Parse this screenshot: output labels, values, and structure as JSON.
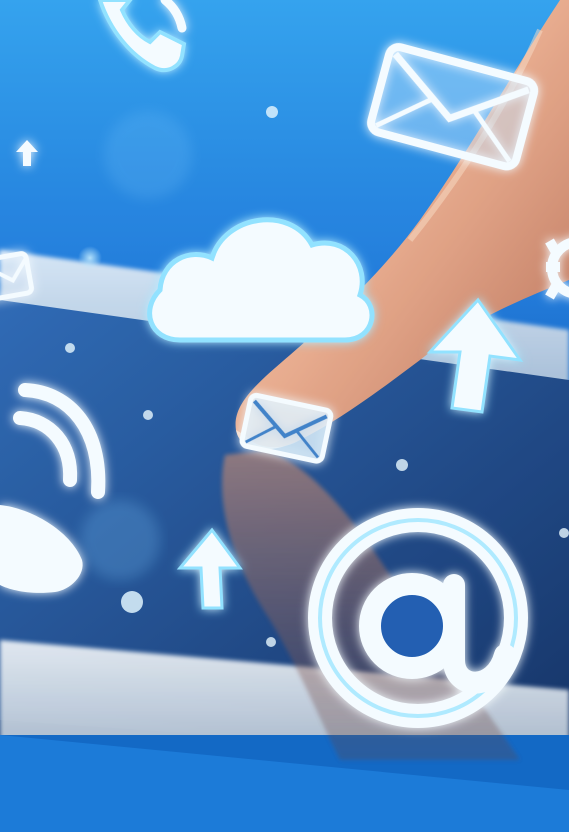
{
  "scene": {
    "description_label": "",
    "colors": {
      "background_top": "#1b77d9",
      "background_mid": "#0d4fa8",
      "background_bottom": "#0a2a5c",
      "glow": "#49c6ff",
      "icon_fill": "#f4fbff",
      "icon_stroke": "#8fe2ff",
      "skin_light": "#f3c6a6",
      "skin_mid": "#d9967a",
      "skin_shadow": "#a8614b",
      "device_frame": "#dfe7ee",
      "device_screen": "#1c4e92"
    },
    "icons": [
      {
        "name": "phone-icon"
      },
      {
        "name": "email-envelope-icon"
      },
      {
        "name": "arrow-up-icon"
      },
      {
        "name": "cloud-icon"
      },
      {
        "name": "at-sign-icon"
      },
      {
        "name": "wifi-icon"
      },
      {
        "name": "gear-icon"
      }
    ]
  }
}
